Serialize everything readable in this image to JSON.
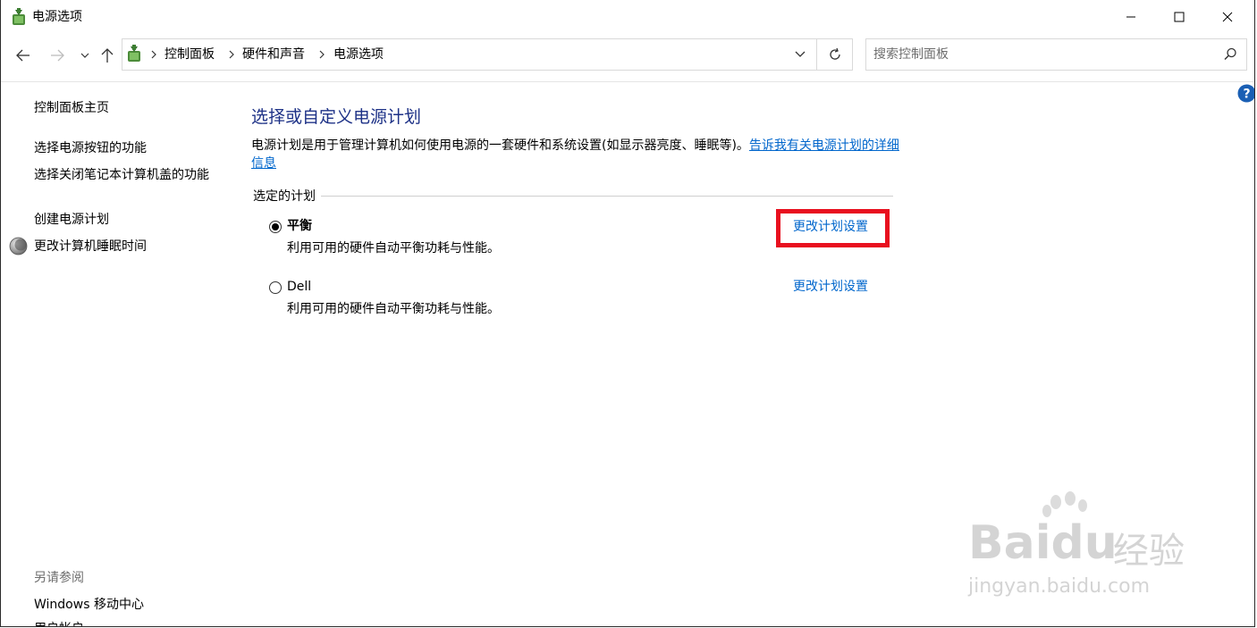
{
  "window": {
    "title": "电源选项"
  },
  "nav": {
    "breadcrumbs": [
      "控制面板",
      "硬件和声音",
      "电源选项"
    ],
    "search_placeholder": "搜索控制面板"
  },
  "sidebar": {
    "links": [
      "控制面板主页",
      "选择电源按钮的功能",
      "选择关闭笔记本计算机盖的功能",
      "创建电源计划",
      "更改计算机睡眠时间"
    ],
    "see_also_label": "另请参阅",
    "see_also_links": [
      "Windows 移动中心",
      "用户帐户"
    ]
  },
  "main": {
    "title": "选择或自定义电源计划",
    "intro_text": "电源计划是用于管理计算机如何使用电源的一套硬件和系统设置(如显示器亮度、睡眠等)。",
    "intro_link": "告诉我有关电源计划的详细信息",
    "group_label": "选定的计划",
    "plans": [
      {
        "name": "平衡",
        "description": "利用可用的硬件自动平衡功耗与性能。",
        "link": "更改计划设置",
        "selected": true
      },
      {
        "name": "Dell",
        "description": "利用可用的硬件自动平衡功耗与性能。",
        "link": "更改计划设置",
        "selected": false
      }
    ]
  },
  "watermark": {
    "brand": "Baidu",
    "brand_cn": "经验",
    "url": "jingyan.baidu.com"
  },
  "colors": {
    "title_blue": "#1e3287",
    "link_blue": "#0066cc",
    "highlight_red": "#e8101f"
  }
}
